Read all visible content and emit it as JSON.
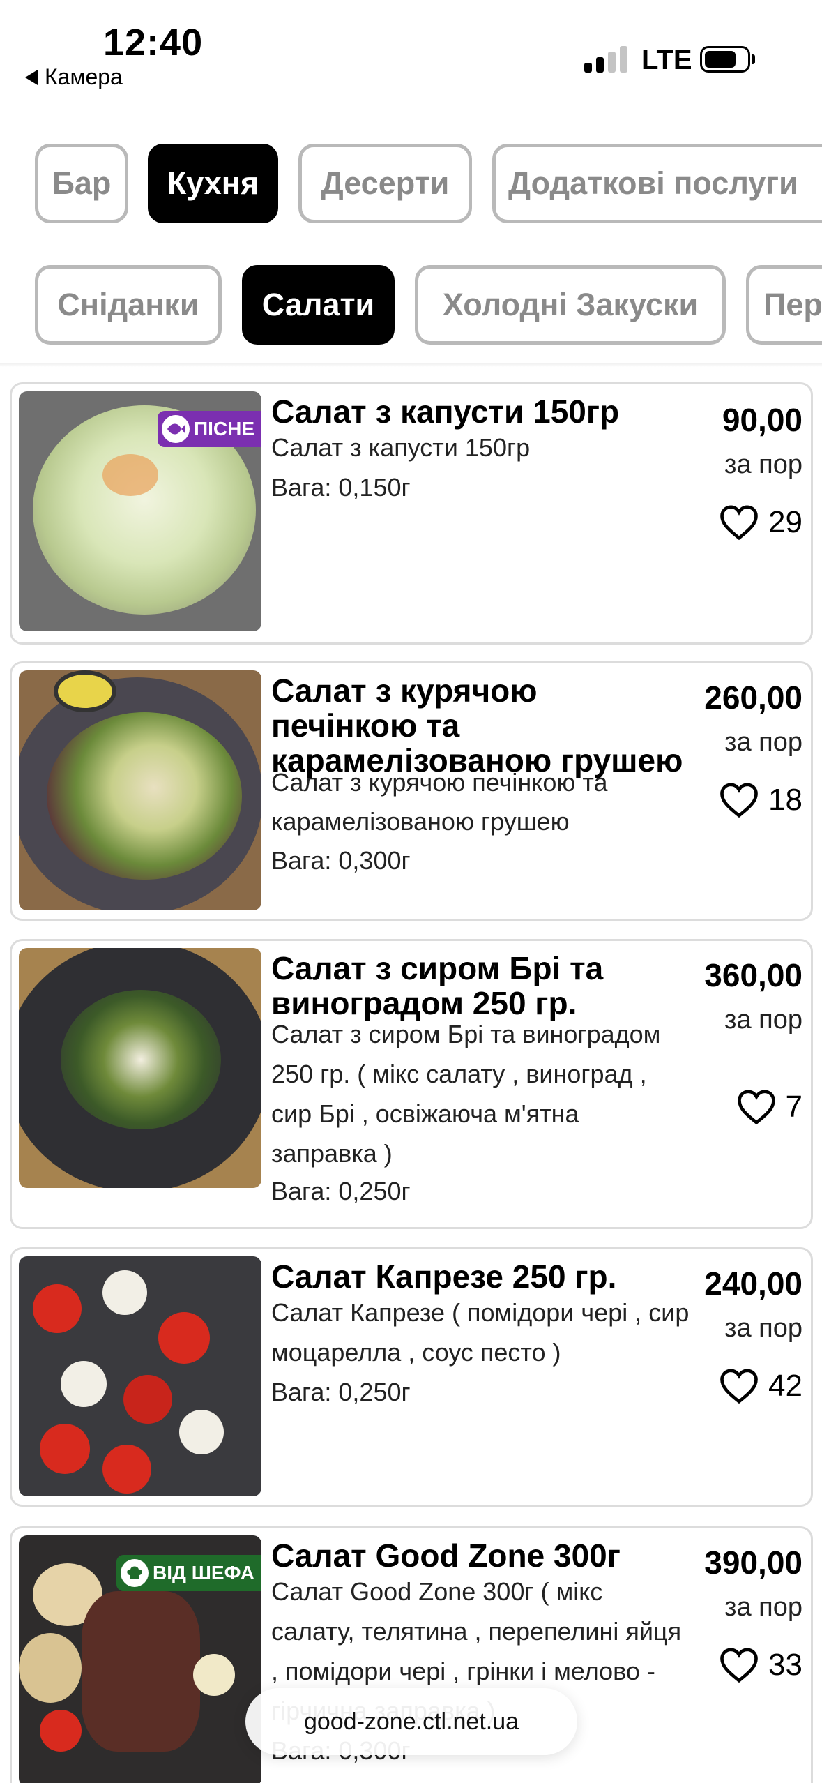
{
  "status_bar": {
    "time": "12:40",
    "back_label": "Камера",
    "network": "LTE"
  },
  "categories": [
    {
      "label": "Бар",
      "active": false
    },
    {
      "label": "Кухня",
      "active": true
    },
    {
      "label": "Десерти",
      "active": false
    },
    {
      "label": "Додаткові послуги",
      "active": false
    }
  ],
  "subcategories": [
    {
      "label": "Сніданки",
      "active": false
    },
    {
      "label": "Салати",
      "active": true
    },
    {
      "label": "Холодні Закуски",
      "active": false
    },
    {
      "label": "Пер",
      "active": false
    }
  ],
  "items": [
    {
      "title": "Салат з капусти 150гр",
      "description": "Салат з капусти 150гр",
      "weight": "Вага: 0,150г",
      "price": "90,00",
      "unit": "за пор",
      "likes": "29",
      "badge": "ПІСНЕ"
    },
    {
      "title": "Салат з курячою печінкою та карамелізованою грушею",
      "description": "Салат з курячою печінкою та карамелізованою грушею",
      "weight": "Вага: 0,300г",
      "price": "260,00",
      "unit": "за пор",
      "likes": "18"
    },
    {
      "title": "Салат з сиром Брі та виноградом 250 гр.",
      "description": "Салат з сиром Брі та виноградом 250 гр. ( мікс салату , виноград , сир Брі , освіжаюча м'ятна заправка )",
      "weight": "Вага: 0,250г",
      "price": "360,00",
      "unit": "за пор",
      "likes": "7"
    },
    {
      "title": "Салат Капрезе 250 гр.",
      "description": "Салат Капрезе ( помідори чері , сир моцарелла , соус песто )",
      "weight": "Вага: 0,250г",
      "price": "240,00",
      "unit": "за пор",
      "likes": "42"
    },
    {
      "title": "Салат Good Zone 300г",
      "description": "Салат Good Zone 300г ( мікс салату, телятина , перепелині яйця , помідори чері , грінки і мелово - гірчична заправка.)",
      "weight": "Вага: 0,300г",
      "price": "390,00",
      "unit": "за пор",
      "likes": "33",
      "badge": "ВІД ШЕФА"
    }
  ],
  "browser": {
    "url": "good-zone.ctl.net.ua"
  },
  "colors": {
    "active_chip": "#000000",
    "inactive_chip_border": "#b9b9b9",
    "lenten_badge": "#7b2fb0",
    "chef_badge": "#1f6b2a"
  }
}
